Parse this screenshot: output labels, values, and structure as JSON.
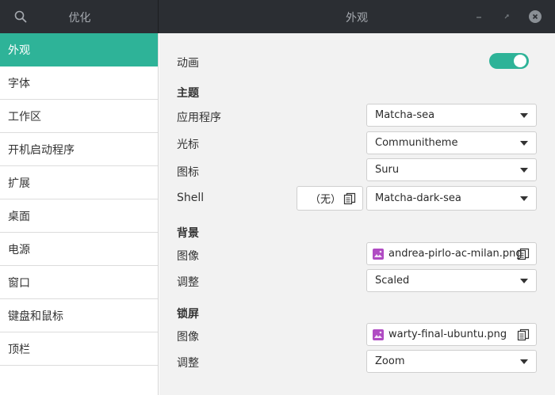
{
  "header": {
    "left_title": "优化",
    "title": "外观",
    "icons": {
      "search": "search-icon",
      "minimize": "minimize-icon",
      "maximize": "maximize-icon",
      "close": "close-icon"
    }
  },
  "sidebar": {
    "items": [
      {
        "label": "外观",
        "active": true
      },
      {
        "label": "字体"
      },
      {
        "label": "工作区"
      },
      {
        "label": "开机启动程序"
      },
      {
        "label": "扩展"
      },
      {
        "label": "桌面"
      },
      {
        "label": "电源"
      },
      {
        "label": "窗口"
      },
      {
        "label": "键盘和鼠标"
      },
      {
        "label": "顶栏"
      }
    ]
  },
  "main": {
    "animation": {
      "label": "动画",
      "enabled": true
    },
    "themes": {
      "title": "主题",
      "applications": {
        "label": "应用程序",
        "value": "Matcha-sea"
      },
      "cursor": {
        "label": "光标",
        "value": "Communitheme"
      },
      "icons": {
        "label": "图标",
        "value": "Suru"
      },
      "shell": {
        "label": "Shell",
        "file_value": "（无）",
        "value": "Matcha-dark-sea"
      }
    },
    "background": {
      "title": "背景",
      "image": {
        "label": "图像",
        "value": "andrea-pirlo-ac-milan.png"
      },
      "adjustment": {
        "label": "调整",
        "value": "Scaled"
      }
    },
    "lock_screen": {
      "title": "锁屏",
      "image": {
        "label": "图像",
        "value": "warty-final-ubuntu.png"
      },
      "adjustment": {
        "label": "调整",
        "value": "Zoom"
      }
    }
  },
  "colors": {
    "accent": "#2eb398",
    "header_bg": "#2b2e33",
    "panel_bg": "#f2f2f2",
    "file_icon": "#b04bc3"
  }
}
